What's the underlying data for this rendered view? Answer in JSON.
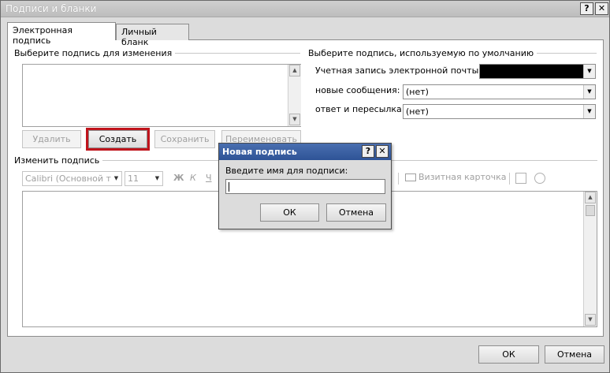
{
  "window": {
    "title": "Подписи и бланки",
    "help_label": "?",
    "close_label": "✕"
  },
  "tabs": [
    {
      "label": "Электронная подпись",
      "active": true
    },
    {
      "label": "Личный бланк",
      "active": false
    }
  ],
  "select_group": {
    "title": "Выберите подпись для изменения",
    "buttons": {
      "delete": "Удалить",
      "create": "Создать",
      "save": "Сохранить",
      "rename": "Переименовать"
    }
  },
  "default_group": {
    "title": "Выберите подпись, используемую по умолчанию",
    "account_label": "Учетная запись электронной почты:",
    "new_messages_label": "новые сообщения:",
    "new_messages_value": "(нет)",
    "replies_label": "ответ и пересылка:",
    "replies_value": "(нет)"
  },
  "edit_group": {
    "title": "Изменить подпись",
    "font_value": "Calibri (Основной те",
    "size_value": "11",
    "bold_label": "Ж",
    "italic_label": "К",
    "underline_label": "Ч",
    "business_card_label": "Визитная карточка"
  },
  "footer": {
    "ok": "ОК",
    "cancel": "Отмена"
  },
  "popup": {
    "title": "Новая подпись",
    "help_label": "?",
    "close_label": "✕",
    "prompt": "Введите имя для подписи:",
    "input_value": "",
    "ok": "ОК",
    "cancel": "Отмена"
  }
}
